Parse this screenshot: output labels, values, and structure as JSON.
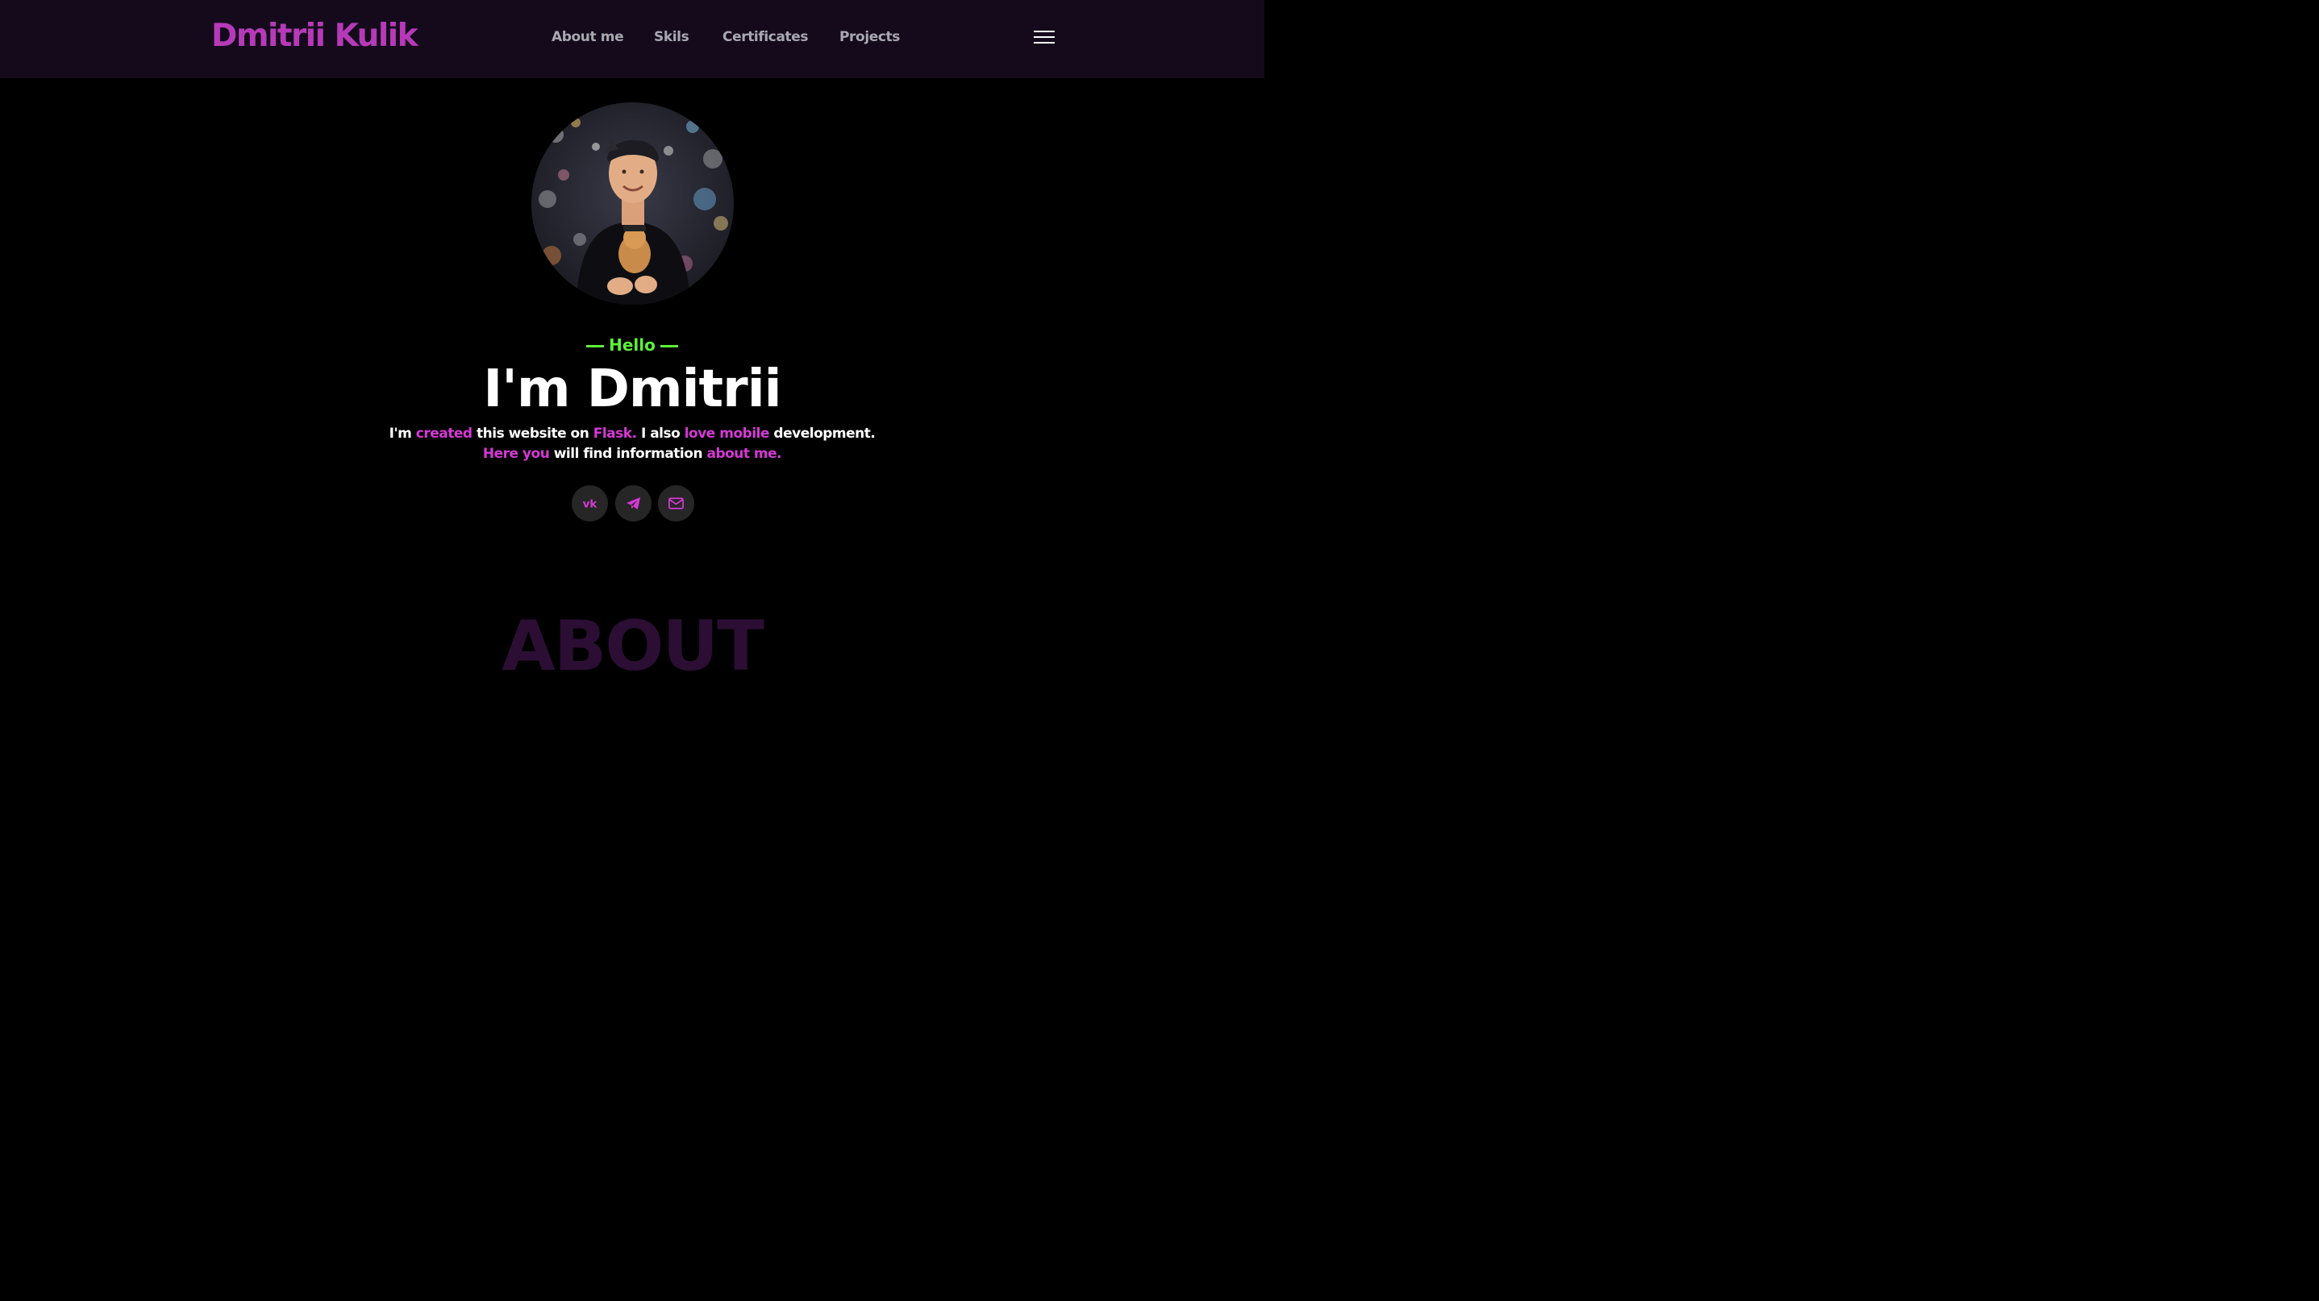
{
  "header": {
    "logo": "Dmitrii Kulik",
    "nav": [
      {
        "label": "About me"
      },
      {
        "label": "Skils"
      },
      {
        "label": "Certificates"
      },
      {
        "label": "Projects"
      }
    ]
  },
  "hero": {
    "greeting": "Hello",
    "heading": "I'm Dmitrii",
    "intro_line1": [
      {
        "text": "I'm "
      },
      {
        "text": "created",
        "accent": true
      },
      {
        "text": " this website on "
      },
      {
        "text": "Flask.",
        "accent": true
      },
      {
        "text": " I also "
      },
      {
        "text": "love mobile",
        "accent": true
      },
      {
        "text": " development."
      }
    ],
    "intro_line2": [
      {
        "text": "Here you",
        "accent": true
      },
      {
        "text": " will find information "
      },
      {
        "text": "about me.",
        "accent": true
      }
    ],
    "social_icons": [
      "vk-icon",
      "telegram-icon",
      "mail-icon"
    ]
  },
  "about": {
    "title": "ABOUT"
  },
  "colors": {
    "header_bg": "#150a1c",
    "logo": "#b63ab8",
    "nav_text": "#a8a8b0",
    "accent_pink": "#d638d6",
    "accent_green": "#5cf03a",
    "about_title": "#2c0e34",
    "social_bg": "#262626"
  }
}
